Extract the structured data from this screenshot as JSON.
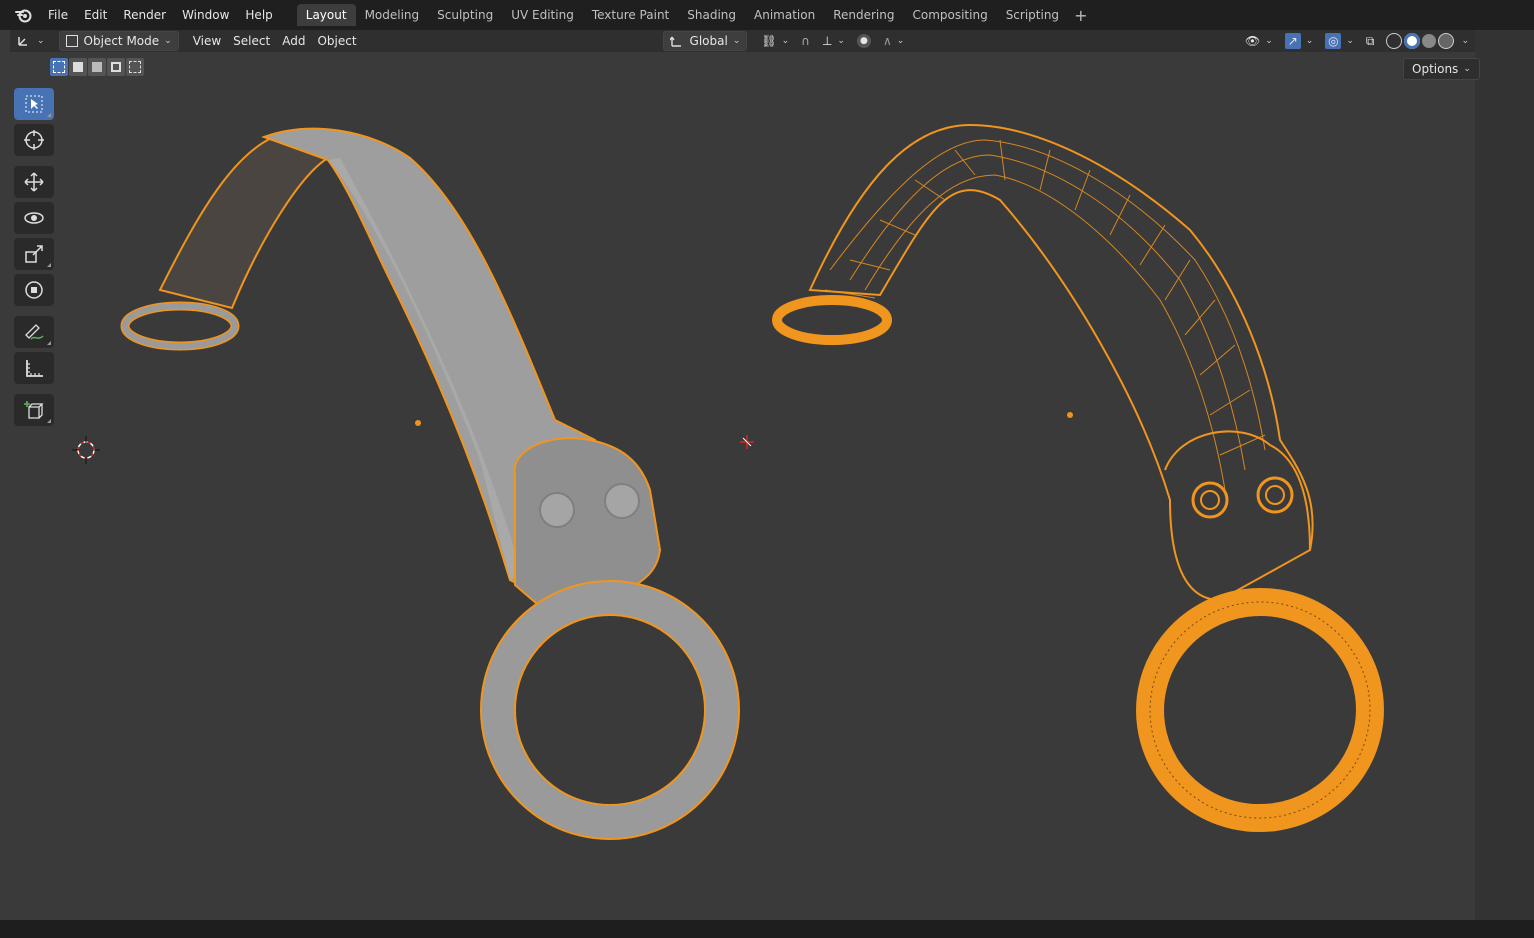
{
  "menu": {
    "items": [
      "File",
      "Edit",
      "Render",
      "Window",
      "Help"
    ]
  },
  "workspaces": {
    "active": "Layout",
    "tabs": [
      "Layout",
      "Modeling",
      "Sculpting",
      "UV Editing",
      "Texture Paint",
      "Shading",
      "Animation",
      "Rendering",
      "Compositing",
      "Scripting"
    ]
  },
  "header": {
    "mode": "Object Mode",
    "menus": [
      "View",
      "Select",
      "Add",
      "Object"
    ],
    "orientation": "Global",
    "options_label": "Options"
  },
  "toolbar": {
    "tools": [
      {
        "name": "select-box",
        "active": true
      },
      {
        "name": "cursor",
        "active": false
      },
      {
        "name": "move",
        "active": false
      },
      {
        "name": "rotate",
        "active": false
      },
      {
        "name": "scale",
        "active": false
      },
      {
        "name": "transform",
        "active": false
      },
      {
        "name": "annotate",
        "active": false
      },
      {
        "name": "measure",
        "active": false
      },
      {
        "name": "add-cube",
        "active": false
      }
    ]
  },
  "scene": {
    "selection_color": "#f0951e",
    "mesh_color": "#a2a2a2",
    "background_color": "#3a3a3a",
    "objects": [
      "collar-strap-solid",
      "collar-strap-wireframe"
    ]
  },
  "colors": {
    "accent": "#4772b3",
    "topbar": "#1f1f1f",
    "header": "#2f2f2f"
  }
}
